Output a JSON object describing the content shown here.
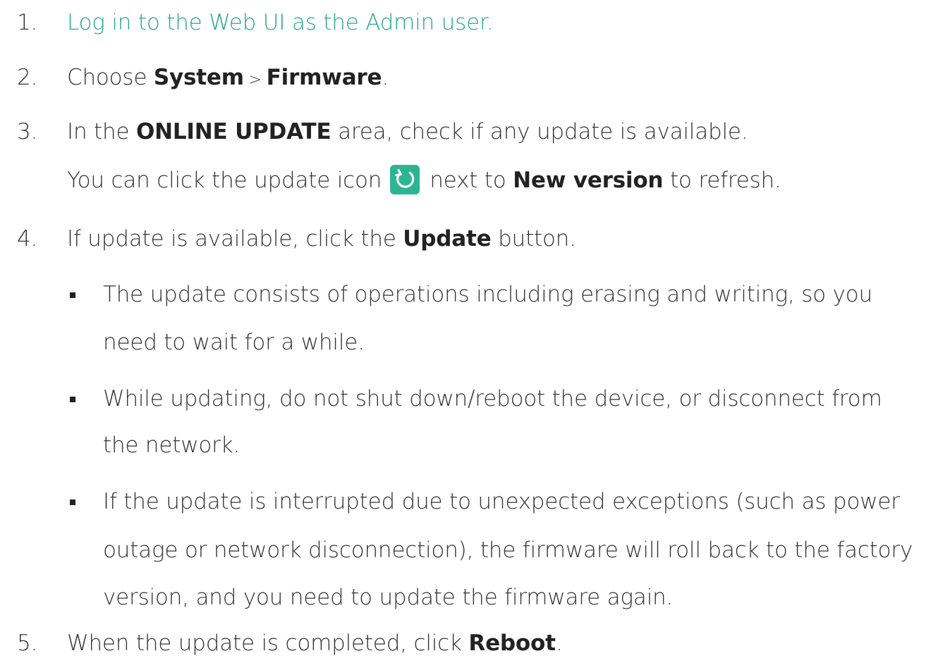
{
  "steps": [
    {
      "num": "1.",
      "link_text": "Log in to the Web UI as the Admin user."
    },
    {
      "num": "2.",
      "pre": "Choose ",
      "b1": "System",
      "sep": " > ",
      "b2": "Firmware",
      "post": "."
    },
    {
      "num": "3.",
      "pre": "In the ",
      "bold": "ONLINE UPDATE",
      "post": " area, check if any update is available.",
      "line2_pre": "You can click the update icon",
      "line2_mid": "next to ",
      "line2_bold": "New version",
      "line2_post": " to refresh.",
      "icon": "refresh-icon",
      "icon_color": "#2bb593"
    },
    {
      "num": "4.",
      "pre": "If update is available, click the ",
      "bold": "Update",
      "post": " button.",
      "bullets": [
        {
          "line1": "The update consists of operations including erasing and writing, so you",
          "line2": "need to wait for a while."
        },
        {
          "line1": "While updating, do not shut down/reboot the device, or disconnect from",
          "line2": "the network."
        },
        {
          "line1": "If the update is interrupted due to unexpected exceptions (such as power",
          "line2": "outage or network disconnection), the firmware will roll back to the factory",
          "line3": "version, and you need to update the firmware again."
        }
      ]
    },
    {
      "num": "5.",
      "pre": "When the update is completed, click ",
      "bold": "Reboot",
      "post": "."
    }
  ],
  "colors": {
    "link": "#26a68a",
    "text": "#333333"
  }
}
